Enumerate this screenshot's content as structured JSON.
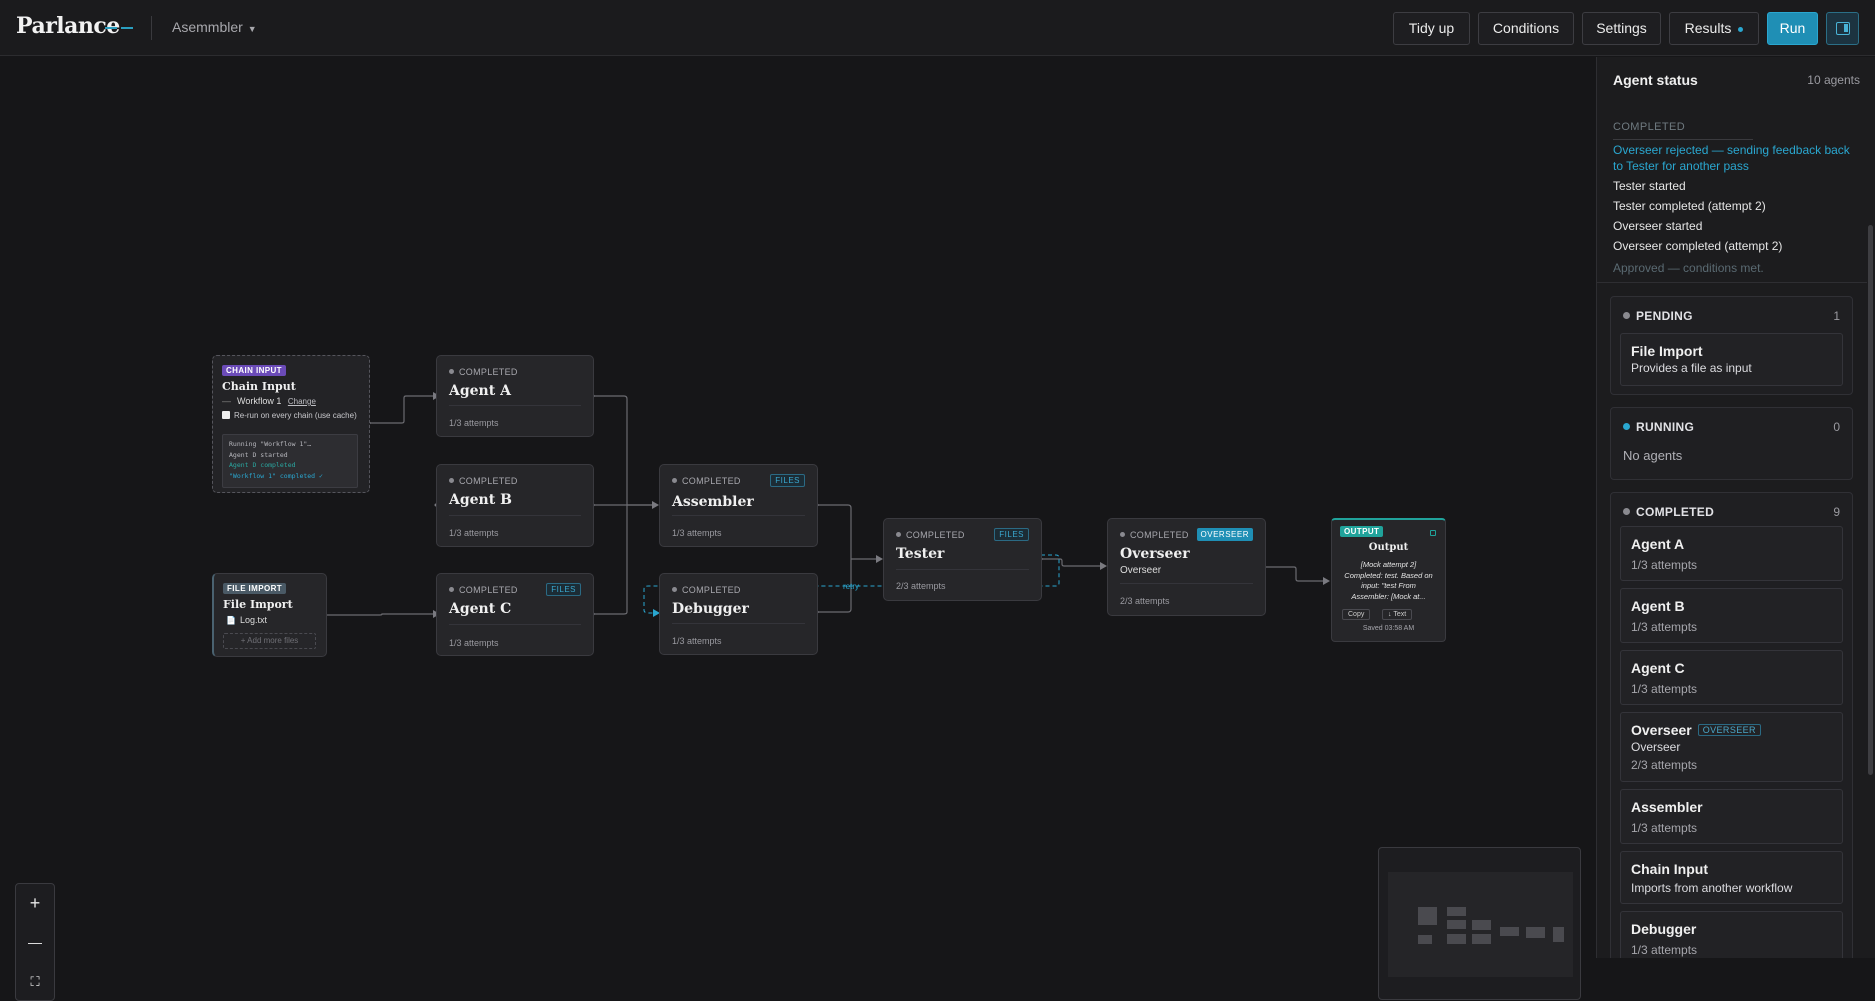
{
  "app": {
    "brand": "Parlance",
    "workflow_name": "Asemmbler"
  },
  "toolbar": {
    "tidy_up": "Tidy up",
    "conditions": "Conditions",
    "settings": "Settings",
    "results": "Results",
    "run": "Run"
  },
  "nodes": {
    "chain_input": {
      "tag": "CHAIN INPUT",
      "title": "Chain Input",
      "workflow": "Workflow 1",
      "change": "Change",
      "rerun": "Re-run on every chain (use cache)",
      "log": [
        "Running \"Workflow 1\"…",
        "Agent D started",
        "Agent D completed",
        "\"Workflow 1\" completed ✓"
      ]
    },
    "file_import": {
      "tag": "FILE IMPORT",
      "title": "File Import",
      "file": "Log.txt",
      "add_more": "+ Add more files"
    },
    "agent_a": {
      "status": "COMPLETED",
      "title": "Agent A",
      "attempts": "1/3 attempts"
    },
    "agent_b": {
      "status": "COMPLETED",
      "title": "Agent B",
      "attempts": "1/3 attempts"
    },
    "agent_c": {
      "status": "COMPLETED",
      "title": "Agent C",
      "attempts": "1/3 attempts",
      "files": "FILES"
    },
    "assembler": {
      "status": "COMPLETED",
      "title": "Assembler",
      "attempts": "1/3 attempts",
      "files": "FILES"
    },
    "debugger": {
      "status": "COMPLETED",
      "title": "Debugger",
      "attempts": "1/3 attempts"
    },
    "tester": {
      "status": "COMPLETED",
      "title": "Tester",
      "attempts": "2/3 attempts",
      "files": "FILES"
    },
    "overseer": {
      "status": "COMPLETED",
      "title": "Overseer",
      "subtitle": "Overseer",
      "attempts": "2/3 attempts",
      "tag": "OVERSEER"
    },
    "retry_label": "retry",
    "output": {
      "tag": "OUTPUT",
      "title": "Output",
      "text": "[Mock attempt 2] Completed: test. Based on input: \"test From Assembler: [Mock at...",
      "copy": "Copy",
      "download": "↓ Text",
      "saved": "Saved 03:58 AM"
    }
  },
  "zoom": {
    "in": "+",
    "out": "—",
    "fit": "⛶"
  },
  "sidebar": {
    "title": "Agent status",
    "count": "10 agents",
    "log_header": "COMPLETED",
    "log_blue": "Overseer rejected — sending feedback back to Tester for another pass",
    "log_lines": [
      "Tester started",
      "Tester completed (attempt 2)",
      "Overseer started",
      "Overseer completed (attempt 2)"
    ],
    "log_dim": "Approved — conditions met.",
    "groups": {
      "pending": {
        "label": "PENDING",
        "count": "1"
      },
      "running": {
        "label": "RUNNING",
        "count": "0",
        "empty": "No agents"
      },
      "completed": {
        "label": "COMPLETED",
        "count": "9"
      }
    },
    "pending_card": {
      "name": "File Import",
      "desc": "Provides a file as input"
    },
    "cards": [
      {
        "name": "Agent A",
        "sub": "1/3 attempts"
      },
      {
        "name": "Agent B",
        "sub": "1/3 attempts"
      },
      {
        "name": "Agent C",
        "sub": "1/3 attempts"
      },
      {
        "name": "Overseer",
        "tag": "OVERSEER",
        "desc": "Overseer",
        "sub": "2/3 attempts"
      },
      {
        "name": "Assembler",
        "sub": "1/3 attempts"
      },
      {
        "name": "Chain Input",
        "desc": "Imports from another workflow"
      },
      {
        "name": "Debugger",
        "sub": "1/3 attempts"
      }
    ]
  },
  "colors": {
    "accent": "#1f8fb5",
    "output": "#20a39b",
    "chain_tag": "#6b4bb8",
    "file_tag": "#4a5a66"
  }
}
